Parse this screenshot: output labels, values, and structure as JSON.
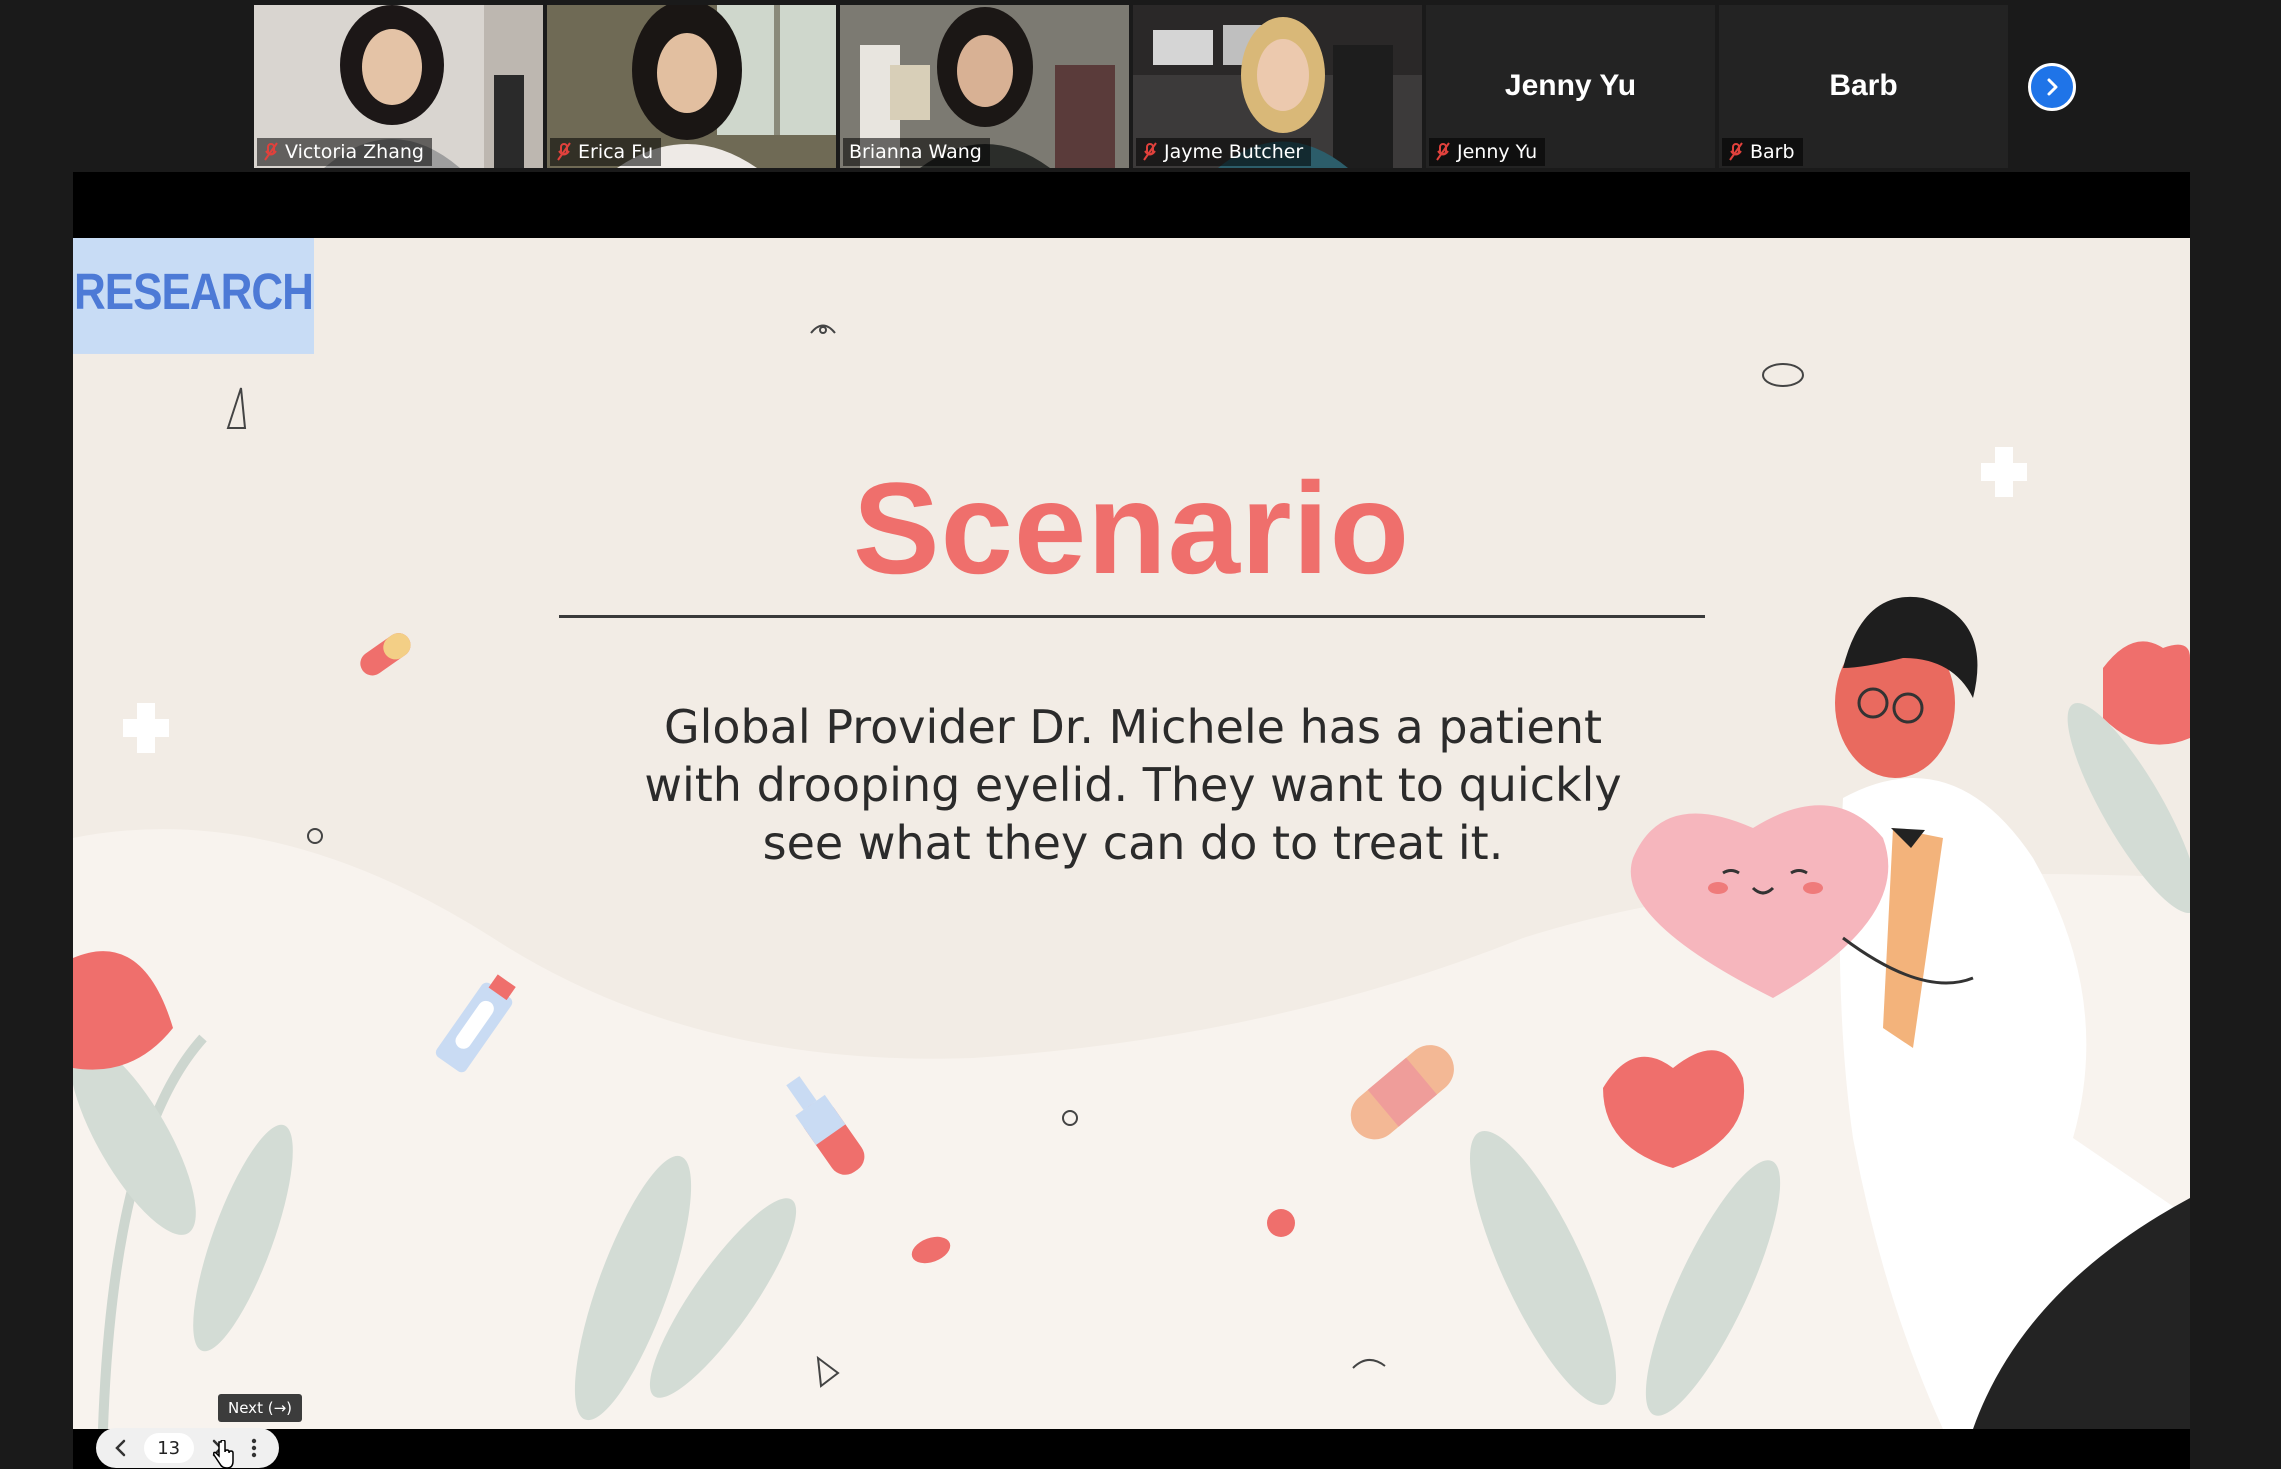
{
  "participants": [
    {
      "name": "Victoria Zhang",
      "has_video": true,
      "muted": true
    },
    {
      "name": "Erica Fu",
      "has_video": true,
      "muted": true
    },
    {
      "name": "Brianna Wang",
      "has_video": true,
      "muted": false,
      "active_speaker": true
    },
    {
      "name": "Jayme Butcher",
      "has_video": true,
      "muted": true
    },
    {
      "name": "Jenny Yu",
      "has_video": false,
      "muted": true,
      "display_name": "Jenny Yu"
    },
    {
      "name": "Barb",
      "has_video": false,
      "muted": true,
      "display_name": "Barb"
    }
  ],
  "strip_next_icon": "chevron-right-icon",
  "slide": {
    "tag": "RESEARCH",
    "title": "Scenario",
    "body": "Global Provider Dr. Michele has a patient with drooping eyelid. They want to quickly see what they can do to treat it."
  },
  "controls": {
    "tooltip": "Next (→)",
    "page_number": "13",
    "prev_icon": "chevron-left-icon",
    "next_icon": "chevron-right-icon",
    "more_icon": "more-vertical-icon"
  },
  "colors": {
    "accent_red": "#ef6f6c",
    "tag_bg": "#c8dcf5",
    "tag_text": "#4d7ad6",
    "slide_bg": "#f2ece5",
    "active_speaker": "#9acd32",
    "zoom_blue": "#1f74e8"
  }
}
